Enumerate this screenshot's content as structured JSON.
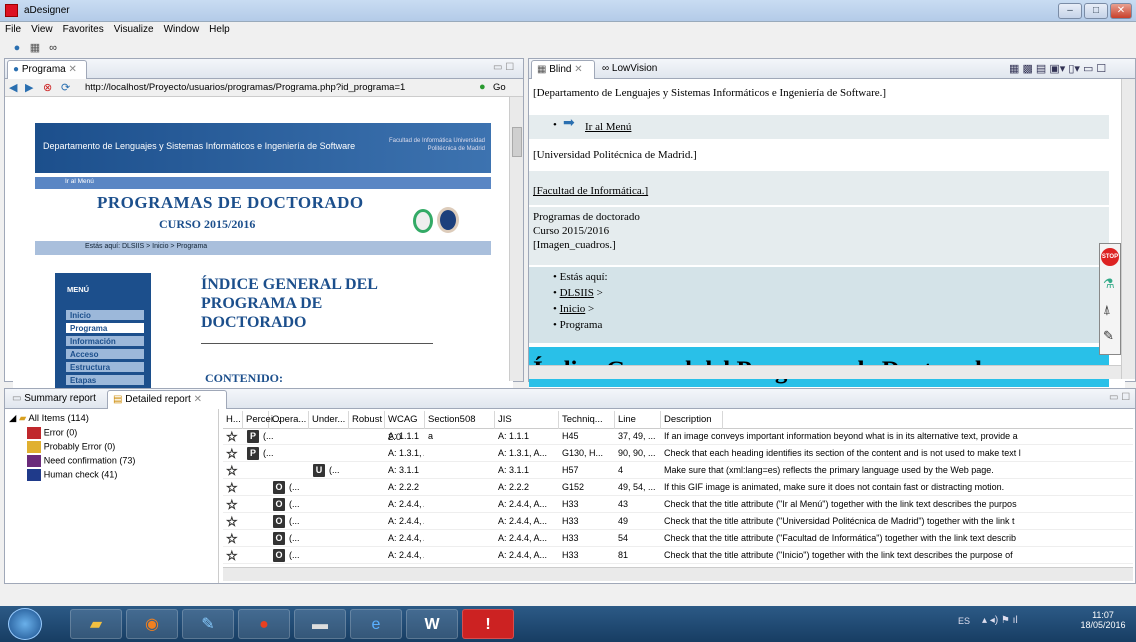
{
  "window": {
    "title": "aDesigner"
  },
  "menu": [
    "File",
    "View",
    "Favorites",
    "Visualize",
    "Window",
    "Help"
  ],
  "browser": {
    "tab": "Programa",
    "url": "http://localhost/Proyecto/usuarios/programas/Programa.php?id_programa=1",
    "go": "Go",
    "page": {
      "header": "Departamento de Lenguajes y Sistemas Informáticos e Ingeniería de Software",
      "header_right": "Facultad de Informática Universidad Politécnica de Madrid",
      "nav": "Ir al Menú",
      "title": "PROGRAMAS DE DOCTORADO",
      "curso": "CURSO 2015/2016",
      "crumb": "Estás aquí: DLSIIS > Inicio > Programa",
      "menu_title": "MENÚ",
      "menu_items": [
        "Inicio",
        "Programa",
        "Información",
        "Acceso",
        "Estructura",
        "Etapas"
      ],
      "index_title": "ÍNDICE GENERAL DEL PROGRAMA DE DOCTORADO",
      "contenido": "CONTENIDO:"
    }
  },
  "blind": {
    "tabs": [
      "Blind",
      "LowVision"
    ],
    "lines": {
      "l1": "[Departamento de Lenguajes y Sistemas Informáticos e Ingeniería de Software.]",
      "l2": "Ir al Menú",
      "l3": "[Universidad Politécnica de Madrid.]",
      "l4": "[Facultad de Informática.]",
      "l5": "Programas de doctorado",
      "l6": "Curso 2015/2016",
      "l7": "[Imagen_cuadros.]",
      "l8": "Estás aquí:",
      "l9": "DLSIIS",
      "l10": "Inicio",
      "l11": "Programa",
      "l12": "Índice General del Programa de Doctorado"
    },
    "gt": ">"
  },
  "report": {
    "tabs": [
      "Summary report",
      "Detailed report"
    ],
    "tree": {
      "root": "All Items (114)",
      "items": [
        {
          "label": "Error (0)",
          "color": "#c0282c"
        },
        {
          "label": "Probably Error (0)",
          "color": "#e0b030"
        },
        {
          "label": "Need confirmation (73)",
          "color": "#6a2a7a"
        },
        {
          "label": "Human check (41)",
          "color": "#1f3a8a"
        }
      ]
    },
    "columns": [
      "H...",
      "Percei...",
      "Opera...",
      "Under...",
      "Robust",
      "WCAG 2.0",
      "Section508",
      "JIS",
      "Techniq...",
      "Line",
      "Description"
    ],
    "rows": [
      {
        "badge": "P",
        "col": 1,
        "bt": "(...",
        "wcag": "A: 1.1.1",
        "s508": "a",
        "jis": "A: 1.1.1",
        "tech": "H45",
        "line": "37, 49, ...",
        "desc": "If an image conveys important information beyond what is in its alternative text, provide a"
      },
      {
        "badge": "P",
        "col": 1,
        "bt": "(...",
        "wcag": "A: 1.3.1, A...",
        "s508": "",
        "jis": "A: 1.3.1, A...",
        "tech": "G130, H...",
        "line": "90, 90, ...",
        "desc": "Check that each heading identifies its section of the content and is not used to make text l"
      },
      {
        "badge": "U",
        "col": 3,
        "bt": "(...",
        "wcag": "A: 3.1.1",
        "s508": "",
        "jis": "A: 3.1.1",
        "tech": "H57",
        "line": "4",
        "desc": "Make sure that (xml:lang=es) reflects the primary language used by the Web page."
      },
      {
        "badge": "O",
        "col": 2,
        "bt": "(...",
        "wcag": "A: 2.2.2",
        "s508": "",
        "jis": "A: 2.2.2",
        "tech": "G152",
        "line": "49, 54, ...",
        "desc": "If this GIF image is animated, make sure it does not contain fast or distracting motion."
      },
      {
        "badge": "O",
        "col": 2,
        "bt": "(...",
        "wcag": "A: 2.4.4, A...",
        "s508": "",
        "jis": "A: 2.4.4, A...",
        "tech": "H33",
        "line": "43",
        "desc": "Check that the title attribute (\"Ir al Menú\") together with the link text describes the purpos"
      },
      {
        "badge": "O",
        "col": 2,
        "bt": "(...",
        "wcag": "A: 2.4.4, A...",
        "s508": "",
        "jis": "A: 2.4.4, A...",
        "tech": "H33",
        "line": "49",
        "desc": "Check that the title attribute (\"Universidad Politécnica de Madrid\") together with the link t"
      },
      {
        "badge": "O",
        "col": 2,
        "bt": "(...",
        "wcag": "A: 2.4.4, A...",
        "s508": "",
        "jis": "A: 2.4.4, A...",
        "tech": "H33",
        "line": "54",
        "desc": "Check that the title attribute (\"Facultad de Informática\") together with the link text describ"
      },
      {
        "badge": "O",
        "col": 2,
        "bt": "(...",
        "wcag": "A: 2.4.4, A...",
        "s508": "",
        "jis": "A: 2.4.4, A...",
        "tech": "H33",
        "line": "81",
        "desc": "Check that the title attribute (\"Inicio\") together with the link text describes the purpose of"
      }
    ]
  },
  "tray": {
    "lang": "ES",
    "time": "11:07",
    "date": "18/05/2016"
  }
}
